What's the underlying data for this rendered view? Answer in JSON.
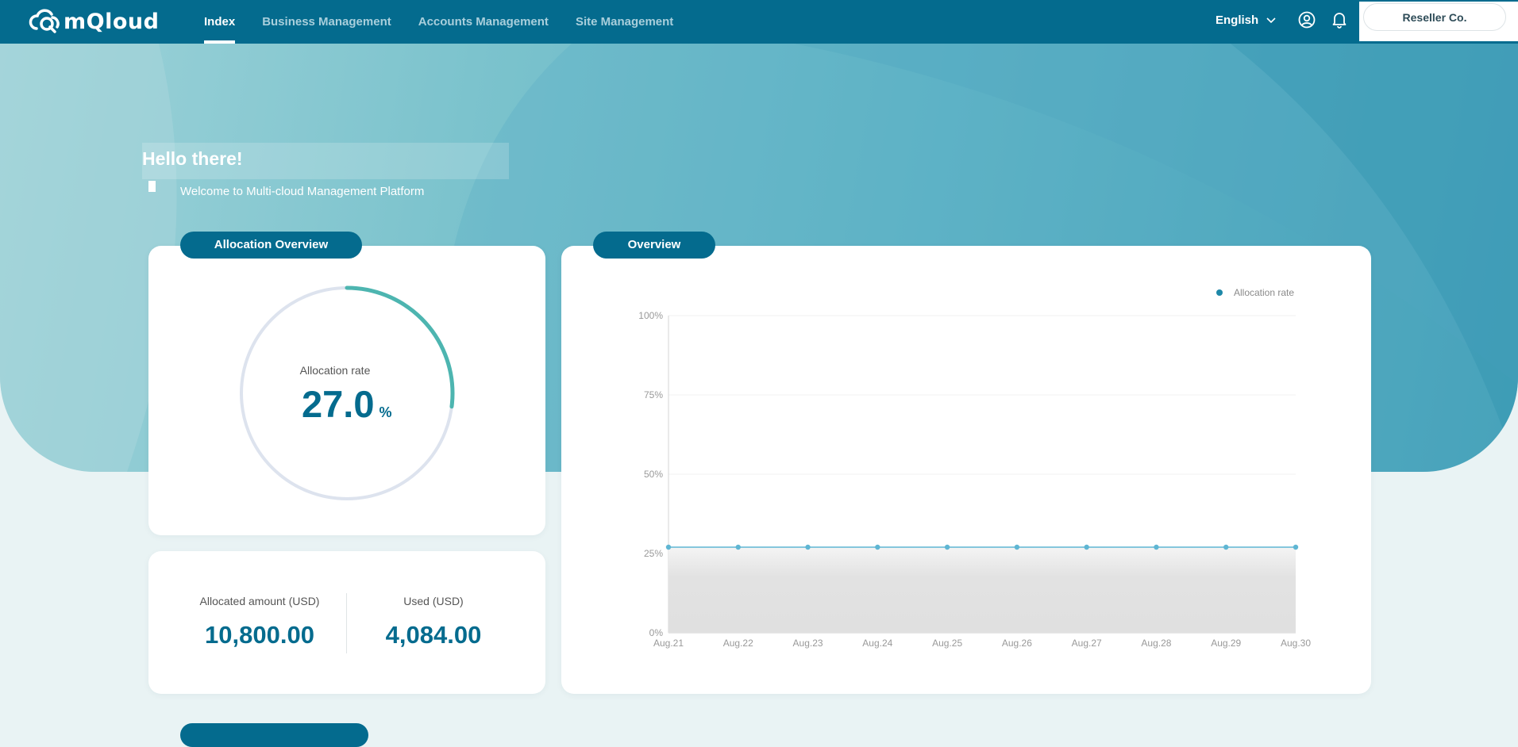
{
  "app": {
    "brand": "mQloud"
  },
  "nav": {
    "items": [
      {
        "label": "Index",
        "active": true
      },
      {
        "label": "Business Management",
        "active": false
      },
      {
        "label": "Accounts Management",
        "active": false
      },
      {
        "label": "Site Management",
        "active": false
      }
    ]
  },
  "header": {
    "language": "English",
    "account": "Reseller Co."
  },
  "welcome": {
    "title": "Hello there!",
    "subtitle": "Welcome to Multi-cloud Management Platform"
  },
  "allocation_overview": {
    "title": "Allocation Overview",
    "rate_label": "Allocation rate",
    "rate_value": "27.0",
    "rate_unit": "%",
    "rate_fraction": 0.27
  },
  "amounts": {
    "allocated_label": "Allocated amount (USD)",
    "allocated_value": "10,800.00",
    "used_label": "Used (USD)",
    "used_value": "4,084.00"
  },
  "overview": {
    "title": "Overview"
  },
  "colors": {
    "primary": "#046b8e",
    "ring_progress": "#4db5b0",
    "ring_track": "#dde3ee",
    "line": "#5fb6d3"
  },
  "chart_data": {
    "type": "area",
    "categories": [
      "Aug.21",
      "Aug.22",
      "Aug.23",
      "Aug.24",
      "Aug.25",
      "Aug.26",
      "Aug.27",
      "Aug.28",
      "Aug.29",
      "Aug.30"
    ],
    "series": [
      {
        "name": "Allocation rate",
        "values": [
          27,
          27,
          27,
          27,
          27,
          27,
          27,
          27,
          27,
          27
        ]
      }
    ],
    "ylim": [
      0,
      100
    ],
    "yticks": [
      "0%",
      "25%",
      "50%",
      "75%",
      "100%"
    ],
    "legend_position": "top-right",
    "grid": true
  }
}
